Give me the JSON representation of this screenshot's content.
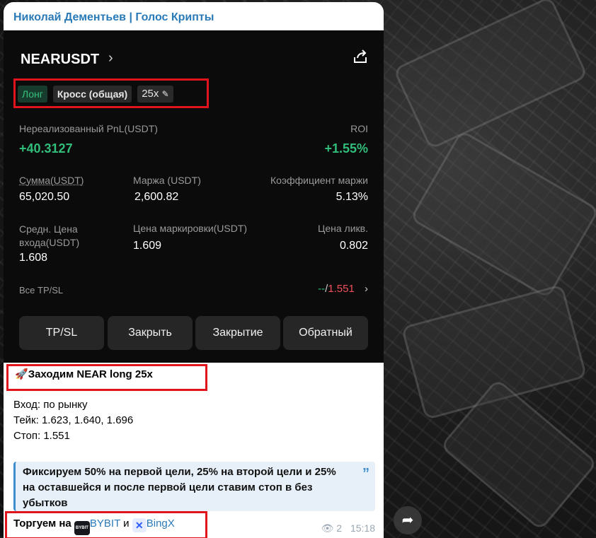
{
  "channel": {
    "title": "Николай Дементьев | Голос Крипты"
  },
  "position": {
    "pair": "NEARUSDT",
    "pair_chevron": "›",
    "share_icon": "share-icon",
    "tags": {
      "side": "Лонг",
      "margin_mode": "Кросс (общая)",
      "leverage": "25x"
    },
    "pnl": {
      "label": "Нереализованный PnL(USDT)",
      "value": "+40.3127"
    },
    "roi": {
      "label": "ROI",
      "value": "+1.55%"
    },
    "size": {
      "label": "Сумма(USDT)",
      "value": "65,020.50"
    },
    "margin": {
      "label": "Маржа (USDT)",
      "value": "2,600.82"
    },
    "margin_ratio": {
      "label": "Коэффициент маржи",
      "value": "5.13%"
    },
    "entry_price": {
      "label": "Средн. Цена входа(USDT)",
      "value": "1.608"
    },
    "mark_price": {
      "label": "Цена маркировки(USDT)",
      "value": "1.609"
    },
    "liq_price": {
      "label": "Цена ликв.",
      "value": "0.802"
    },
    "tpsl": {
      "label": "Все TP/SL",
      "tp": "--",
      "sep": "/",
      "sl": "1.551"
    },
    "buttons": {
      "tpsl": "TP/SL",
      "close": "Закрыть",
      "close_all": "Закрытие",
      "reverse": "Обратный"
    },
    "colors": {
      "green": "#31bd7a",
      "red": "#f0505a"
    }
  },
  "message": {
    "headline": "Заходим NEAR long 25x",
    "entry": "Вход: по рынку",
    "take": "Тейк: 1.623, 1.640, 1.696",
    "stop": "Стоп: 1.551",
    "quote": "Фиксируем 50% на первой цели, 25% на второй цели и 25% на оставшейся и после первой цели ставим стоп в без убытков",
    "trade_prefix": "Торгуем на",
    "bybit": "BYBIT",
    "and": "и",
    "bingx": "BingX",
    "views": "2",
    "time": "15:18"
  }
}
